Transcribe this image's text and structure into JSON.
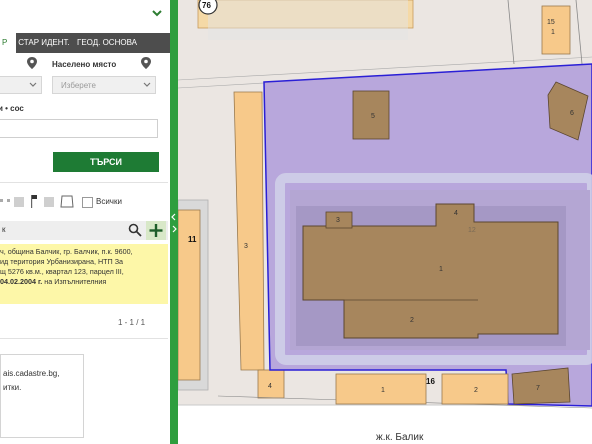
{
  "panel": {
    "tabs": [
      {
        "label": "Р",
        "active": true
      },
      {
        "label": "СТАР ИДЕНТ.",
        "active": false
      },
      {
        "label": "ГЕОД. ОСНОВА",
        "active": false
      }
    ],
    "settlement_label": "Населено място",
    "settlement_placeholder": "Изберете",
    "field_label_partial": "и • сос",
    "search_button": "ТЪРСИ",
    "all_label": "Всички",
    "search_input_partial": "к",
    "result_lines": [
      "ч, община Балчик, гр. Балчик, п.к. 9600,",
      "ид територия Урбанизирана, НТП За",
      "щ 5276 кв.м., квартал 123, парцел III,",
      "04.02.2004 г. на Изпълнителния"
    ],
    "result_bold_date": "04.02.2004 г.",
    "pagination": "1 - 1 / 1",
    "info_lines": [
      "ais.cadastre.bg,",
      "итки."
    ]
  },
  "map": {
    "street_label": "ж.к. Балик",
    "labels": {
      "circle_76": "76",
      "bldg_top_15": "15",
      "bldg_top_1": "1",
      "bldg_5": "5",
      "bldg_6": "6",
      "bldg_3_small": "3",
      "bldg_4_small": "4",
      "bldg_main_1": "1",
      "bldg_main_2": "2",
      "bldg_12": "12",
      "left_3": "3",
      "left_4": "4",
      "left_11": "11",
      "bottom_1": "1",
      "bottom_16": "16",
      "bottom_2": "2",
      "bottom_7": "7"
    }
  },
  "colors": {
    "accent_green": "#2e9e3e",
    "search_green": "#1e7b34",
    "parcel_fill": "#b8a7dc",
    "parcel_border": "#2a1fd6",
    "building_brown": "#a7865d",
    "building_orange": "#f7c98a",
    "highlight_yellow": "#fdf7a8"
  }
}
